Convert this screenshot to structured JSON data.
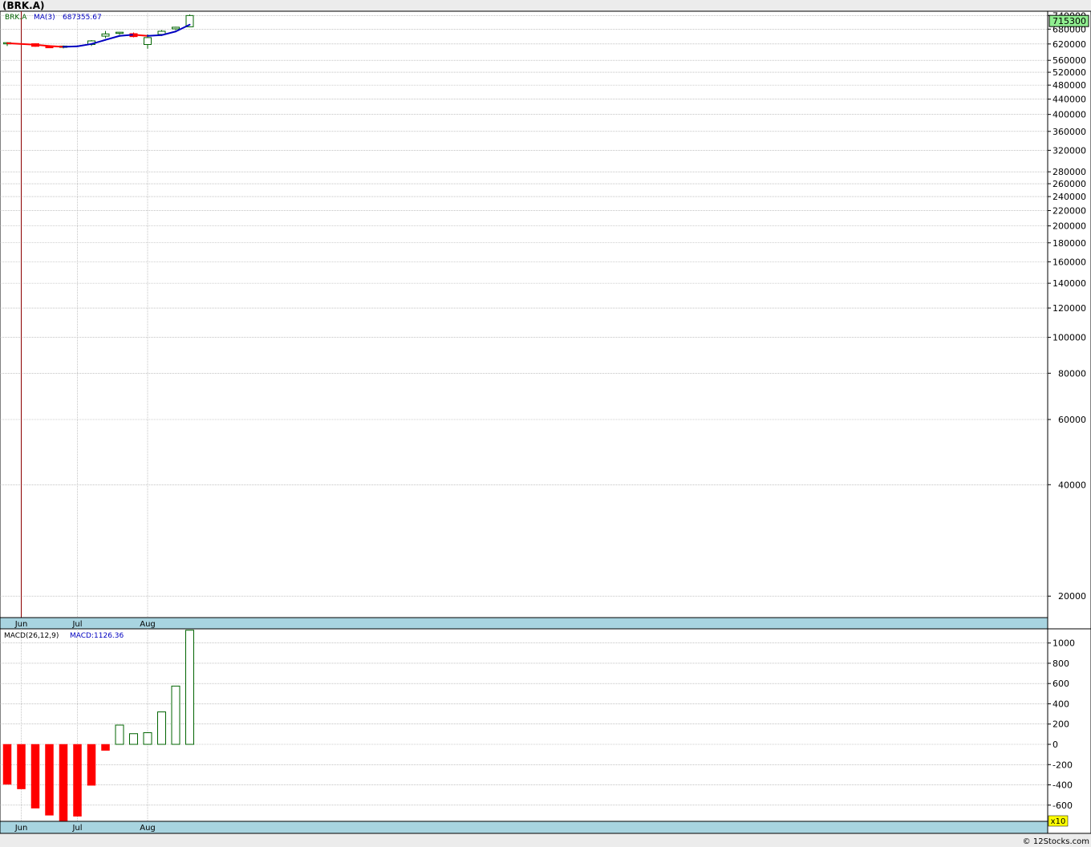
{
  "header": {
    "title": "(BRK.A)"
  },
  "footer": {
    "copyright": "© 12Stocks.com"
  },
  "colors": {
    "up": "#006400",
    "down": "#ff0000",
    "ma_up": "#0000c0",
    "ma_down": "#ff0000",
    "grid": "#a0a0a0",
    "axis_band": "#a8d4e0",
    "price_tag": "#90ee90",
    "multiplier_tag": "#ffff00",
    "event_line": "#8b0000"
  },
  "chart_data": [
    {
      "type": "candlestick",
      "legend": {
        "symbol": "BRK.A",
        "ma_label": "MA(3)",
        "ma_value": "687355.67"
      },
      "y_scale": "log",
      "ylim": [
        17500,
        760000
      ],
      "y_ticks": [
        740000,
        680000,
        620000,
        560000,
        520000,
        480000,
        440000,
        400000,
        360000,
        320000,
        280000,
        260000,
        240000,
        220000,
        200000,
        180000,
        160000,
        140000,
        120000,
        100000,
        80000,
        60000,
        40000,
        20000
      ],
      "current_price": "715300",
      "x_labels": [
        {
          "label": "Jun",
          "week": 1
        },
        {
          "label": "Jul",
          "week": 5
        },
        {
          "label": "Aug",
          "week": 10
        }
      ],
      "event_line_week": 1,
      "candles": [
        {
          "week": 0,
          "open": 622000,
          "high": 627000,
          "low": 612000,
          "close": 625000
        },
        {
          "week": 2,
          "open": 621000,
          "high": 623000,
          "low": 609000,
          "close": 611000
        },
        {
          "week": 3,
          "open": 610000,
          "high": 615000,
          "low": 604000,
          "close": 607000
        },
        {
          "week": 4,
          "open": 607000,
          "high": 614000,
          "low": 603000,
          "close": 612000
        },
        {
          "week": 6,
          "open": 618000,
          "high": 635000,
          "low": 612000,
          "close": 632000
        },
        {
          "week": 7,
          "open": 651000,
          "high": 672000,
          "low": 643000,
          "close": 660000
        },
        {
          "week": 8,
          "open": 663000,
          "high": 668000,
          "low": 657000,
          "close": 667000
        },
        {
          "week": 9,
          "open": 661000,
          "high": 666000,
          "low": 646000,
          "close": 649000
        },
        {
          "week": 10,
          "open": 618000,
          "high": 658000,
          "low": 602000,
          "close": 645000
        },
        {
          "week": 11,
          "open": 658000,
          "high": 676000,
          "low": 654000,
          "close": 671000
        },
        {
          "week": 12,
          "open": 681000,
          "high": 690000,
          "low": 676000,
          "close": 688000
        },
        {
          "week": 13,
          "open": 690000,
          "high": 745000,
          "low": 688000,
          "close": 740000
        }
      ],
      "moving_average": [
        {
          "week": 0,
          "value": 623000
        },
        {
          "week": 2,
          "value": 617000
        },
        {
          "week": 3,
          "value": 612000
        },
        {
          "week": 4,
          "value": 609000
        },
        {
          "week": 5,
          "value": 611000
        },
        {
          "week": 6,
          "value": 620000
        },
        {
          "week": 7,
          "value": 636000
        },
        {
          "week": 8,
          "value": 652000
        },
        {
          "week": 9,
          "value": 657000
        },
        {
          "week": 10,
          "value": 652000
        },
        {
          "week": 11,
          "value": 655000
        },
        {
          "week": 12,
          "value": 670000
        },
        {
          "week": 13,
          "value": 699000
        }
      ]
    },
    {
      "type": "bar",
      "legend": {
        "indicator": "MACD(26,12,9)",
        "value_label": "MACD:1126.36"
      },
      "ylim": [
        -760,
        1140
      ],
      "y_ticks": [
        1000,
        800,
        600,
        400,
        200,
        0,
        -200,
        -400,
        -600
      ],
      "multiplier": "x10",
      "x_labels": [
        {
          "label": "Jun",
          "week": 1
        },
        {
          "label": "Jul",
          "week": 5
        },
        {
          "label": "Aug",
          "week": 10
        }
      ],
      "bars": [
        {
          "week": 0,
          "value": -395
        },
        {
          "week": 1,
          "value": -440
        },
        {
          "week": 2,
          "value": -630
        },
        {
          "week": 3,
          "value": -700
        },
        {
          "week": 4,
          "value": -760
        },
        {
          "week": 5,
          "value": -710
        },
        {
          "week": 6,
          "value": -405
        },
        {
          "week": 7,
          "value": -60
        },
        {
          "week": 8,
          "value": 190
        },
        {
          "week": 9,
          "value": 105
        },
        {
          "week": 10,
          "value": 115
        },
        {
          "week": 11,
          "value": 320
        },
        {
          "week": 12,
          "value": 575
        },
        {
          "week": 13,
          "value": 1126.36
        }
      ]
    }
  ]
}
